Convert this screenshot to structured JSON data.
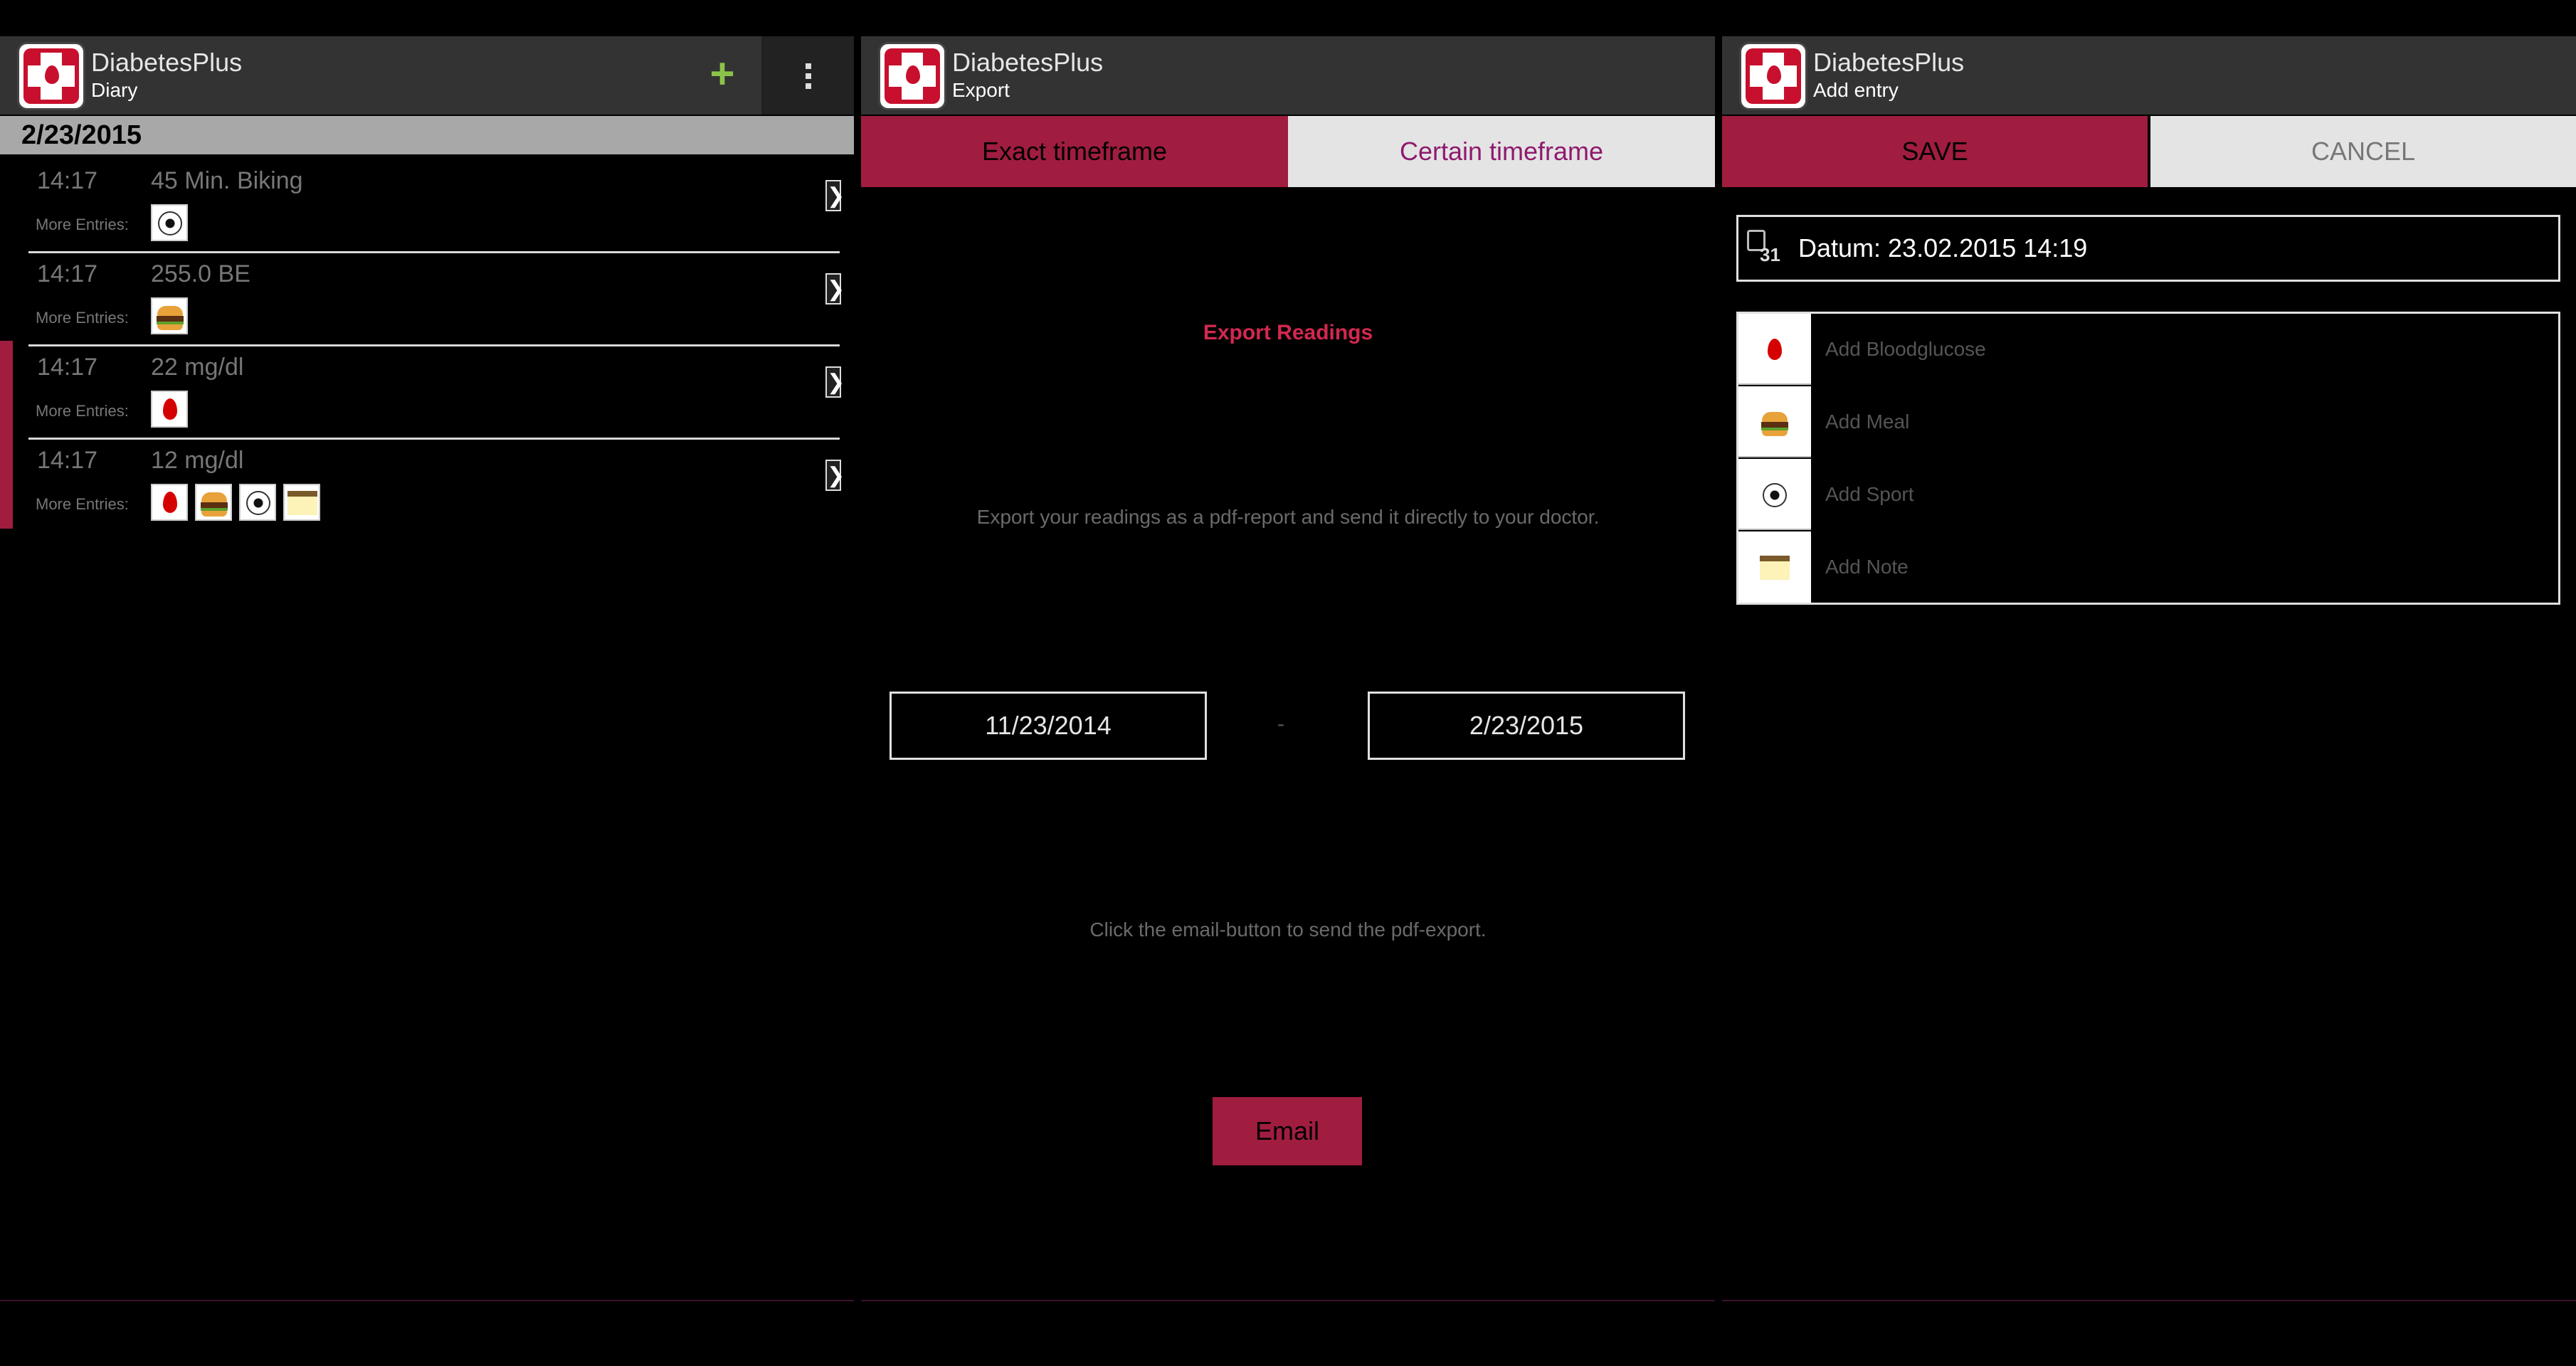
{
  "app_name": "DiabetesPlus",
  "diary": {
    "subtitle": "Diary",
    "add_label": "+",
    "date_header": "2/23/2015",
    "more_entries_label": "More Entries:",
    "entries": [
      {
        "time": "14:17",
        "value": "45 Min. Biking",
        "icons": [
          "soccer-ball-icon"
        ]
      },
      {
        "time": "14:17",
        "value": "255.0 BE",
        "icons": [
          "burger-icon"
        ]
      },
      {
        "time": "14:17",
        "value": "22 mg/dl",
        "icons": [
          "blood-drop-icon"
        ]
      },
      {
        "time": "14:17",
        "value": "12 mg/dl",
        "icons": [
          "blood-drop-icon",
          "burger-icon",
          "soccer-ball-icon",
          "note-icon"
        ]
      }
    ],
    "chevron": "❯"
  },
  "export": {
    "subtitle": "Export",
    "tabs": [
      {
        "label": "Exact timeframe",
        "active": true
      },
      {
        "label": "Certain timeframe",
        "active": false
      }
    ],
    "title": "Export Readings",
    "description": "Export your readings as a pdf-report and send it directly to your doctor.",
    "date_from": "11/23/2014",
    "date_separator": "-",
    "date_to": "2/23/2015",
    "email_hint": "Click the email-button to send the pdf-export.",
    "email_button": "Email"
  },
  "add_entry": {
    "subtitle": "Add entry",
    "save_label": "SAVE",
    "cancel_label": "CANCEL",
    "datum_label": "Datum: 23.02.2015 14:19",
    "calendar_day": "31",
    "items": [
      {
        "label": "Add Bloodglucose",
        "icon": "blood-drop-icon"
      },
      {
        "label": "Add Meal",
        "icon": "burger-icon"
      },
      {
        "label": "Add Sport",
        "icon": "soccer-ball-icon"
      },
      {
        "label": "Add Note",
        "icon": "note-icon"
      }
    ]
  },
  "colors": {
    "accent": "#a01d3f",
    "add_green": "#8bc34a",
    "inactive_tab_text": "#8e1a6e"
  }
}
